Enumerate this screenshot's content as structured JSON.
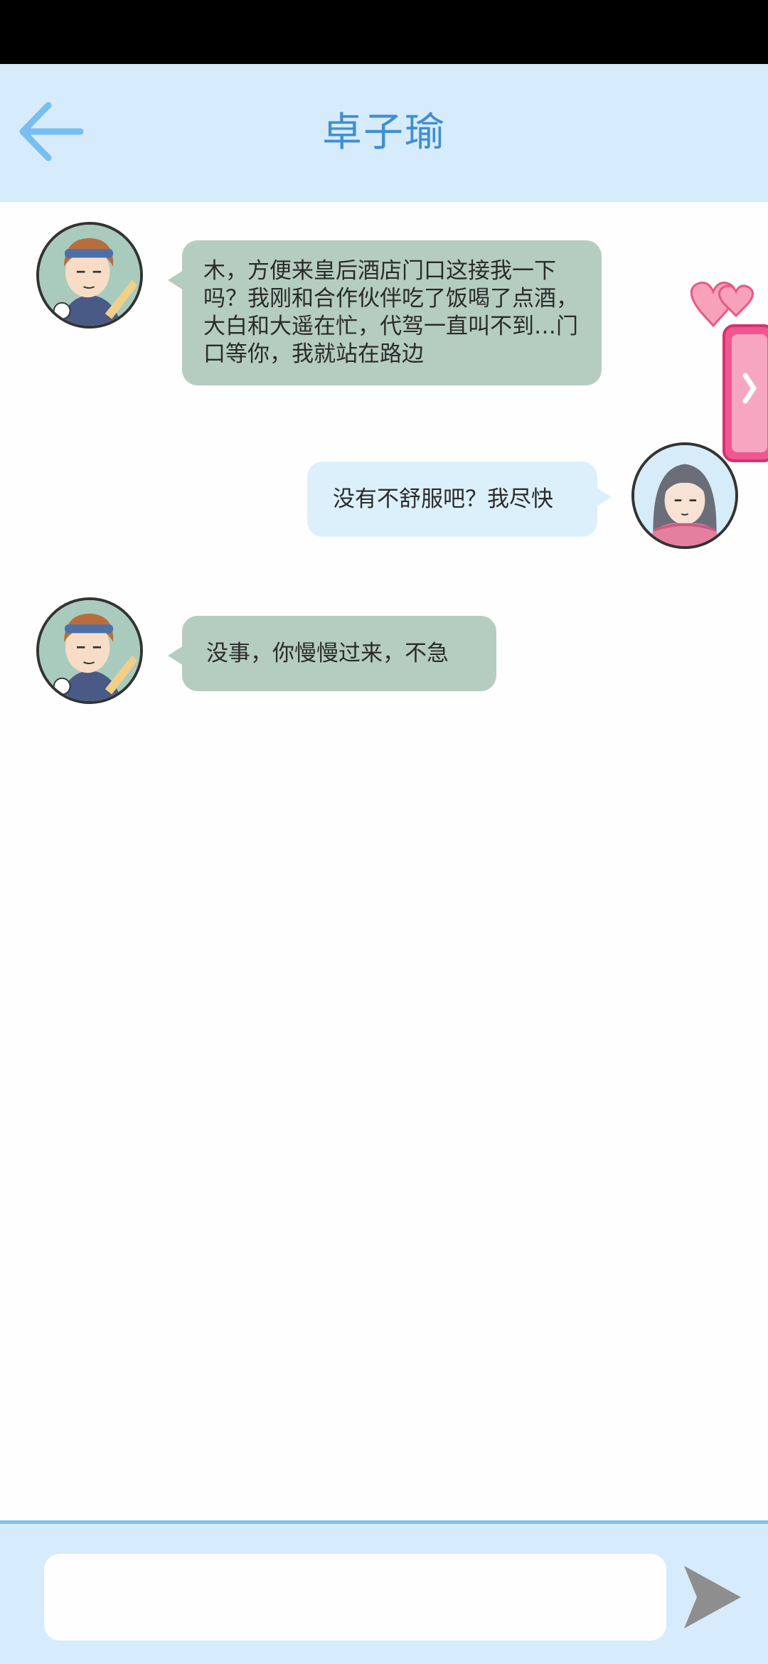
{
  "header": {
    "title": "卓子瑜",
    "back_icon": "arrow-left-icon"
  },
  "messages": [
    {
      "direction": "in",
      "text": "木，方便来皇后酒店门口这接我一下吗？我刚和合作伙伴吃了饭喝了点酒，大白和大遥在忙，代驾一直叫不到…门口等你，我就站在路边"
    },
    {
      "direction": "out",
      "text": "没有不舒服吧？我尽快"
    },
    {
      "direction": "in",
      "text": "没事，你慢慢过来，不急"
    }
  ],
  "input": {
    "value": "",
    "placeholder": ""
  },
  "colors": {
    "header_bg": "#d6ebfb",
    "title": "#3f8fd2",
    "incoming_bubble": "#b5cdbf",
    "outgoing_bubble": "#dcf0fb",
    "side_tab": "#f0568f",
    "send_icon": "#8e8e8e"
  }
}
